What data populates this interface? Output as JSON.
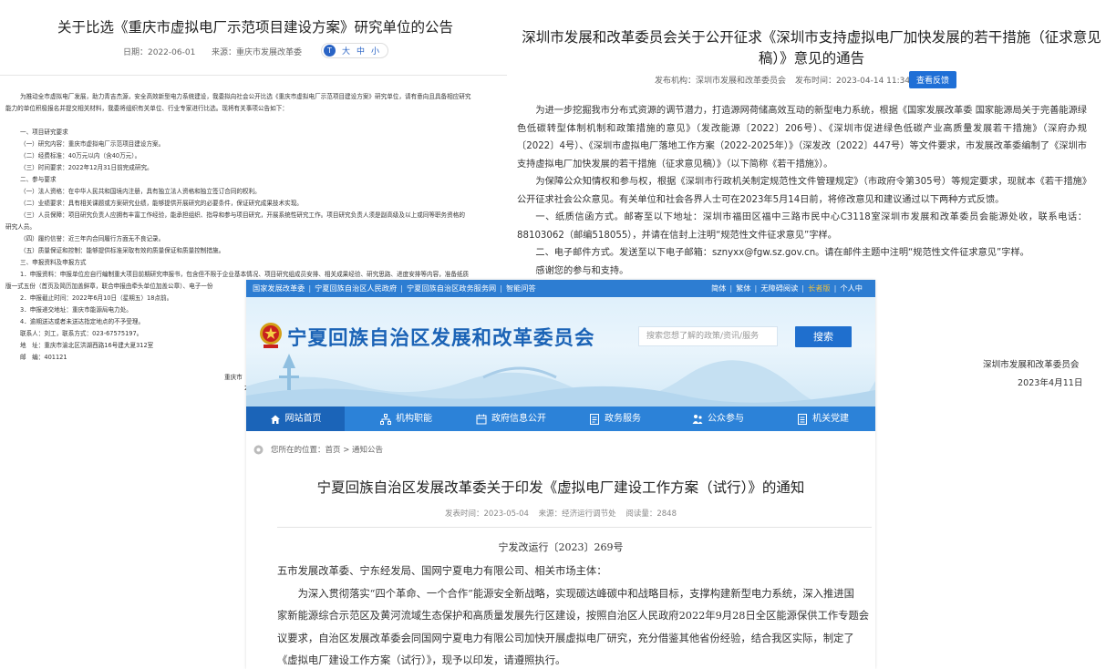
{
  "chongqing": {
    "title": "关于比选《重庆市虚拟电厂示范项目建设方案》研究单位的公告",
    "date": "日期：2022-06-01",
    "source": "来源：重庆市发展改革委",
    "font_size_options": [
      "大",
      "中",
      "小"
    ],
    "font_toggle_icon_text": "T",
    "body_lines": [
      {
        "text": "为推动全市虚拟电厂发展，助力青吉杰源，安全高效新型电力系统建设，我委拟向社会公开比选《重庆市虚拟电厂示范项目建设方案》研究单位，请有意向且具备相应研究",
        "indent": "ind"
      },
      {
        "text": "能力的单位积极报名并提交相关材料，我委将组织有关单位、行业专家进行比选。现将有关事项公告如下：",
        "indent": ""
      },
      {
        "text": "",
        "indent": ""
      },
      {
        "text": "一、项目研究要求",
        "indent": "ind"
      },
      {
        "text": "（一）研究内容：重庆市虚拟电厂示范项目建设方案。",
        "indent": "ind"
      },
      {
        "text": "（二）经费标准：40万元以内（含40万元）。",
        "indent": "ind"
      },
      {
        "text": "（三）时间要求：2022年12月31日前完成研究。",
        "indent": "ind"
      },
      {
        "text": "二、参与要求",
        "indent": "ind"
      },
      {
        "text": "（一）法人资格：在中华人民共和国境内注册，具有独立法人资格和独立签订合同的权利。",
        "indent": "ind"
      },
      {
        "text": "（二）业绩要求：具有相关课题或方案研究业绩，能够提供开展研究的必要条件，保证研究成果技术实现。",
        "indent": "ind"
      },
      {
        "text": "（三）人员保障：项目研究负责人应拥有丰富工作经验，能承担组织、指导和参与项目研究，开展系统性研究工作。项目研究负责人须是副高级及以上或同等职务资格的",
        "indent": "ind"
      },
      {
        "text": "研究人员。",
        "indent": ""
      },
      {
        "text": "（四）履约信誉：近三年内合同履行方面无不良记录。",
        "indent": "ind"
      },
      {
        "text": "（五）质量保证和控制：能够提供标准采取有效的质量保证和质量控制措施。",
        "indent": "ind"
      },
      {
        "text": "三、申报资料及申报方式",
        "indent": "ind"
      },
      {
        "text": "1．申报资料：申报单位应自行编制重大项目前期研究申报书，包含但不限于企业基本情况、项目研究组成员安排、相关成果经验、研究思路、进度安排等内容，准备纸质",
        "indent": "ind"
      },
      {
        "text": "版一式五份（首页及简历加盖鲜章，联合申报由牵头单位加盖公章）、电子一份",
        "indent": ""
      },
      {
        "text": "2．申报截止时间：2022年6月10日（星期五）18点前。",
        "indent": "ind"
      },
      {
        "text": "3．申报递交地址：重庆市能源局电力处。",
        "indent": "ind"
      },
      {
        "text": "4．逾期送达或者未送达指定地点的不予受理。",
        "indent": "ind"
      },
      {
        "text": "联系人：刘工，联系方式：023-67575197。",
        "indent": "ind"
      },
      {
        "text": "地　址：重庆市渝北区洪湖西路16号建大夏312室",
        "indent": "ind"
      },
      {
        "text": "邮　编：401121",
        "indent": "ind"
      }
    ],
    "signature_name": "重庆市",
    "signature_date": "2"
  },
  "shenzhen": {
    "title": "深圳市发展和改革委员会关于公开征求《深圳市支持虚拟电厂加快发展的若干措施（征求意见稿）》意见的通告",
    "publisher": "发布机构：深圳市发展和改革委员会",
    "publish_time": "发布时间：2023-04-14 11:34",
    "feedback_button": "查看反馈",
    "paragraphs": [
      "为进一步挖掘我市分布式资源的调节潜力，打造源网荷储高效互动的新型电力系统，根据《国家发展改革委 国家能源局关于完善能源绿色低碳转型体制机制和政策措施的意见》（发改能源〔2022〕206号）、《深圳市促进绿色低碳产业高质量发展若干措施》（深府办规〔2022〕4号）、《深圳市虚拟电厂落地工作方案（2022-2025年）》（深发改〔2022〕447号）等文件要求，市发展改革委编制了《深圳市支持虚拟电厂加快发展的若干措施（征求意见稿）》（以下简称《若干措施》）。",
      "为保障公众知情权和参与权，根据《深圳市行政机关制定规范性文件管理规定》（市政府令第305号）等规定要求，现就本《若干措施》公开征求社会公众意见。有关单位和社会各界人士可在2023年5月14日前，将修改意见和建议通过以下两种方式反馈。",
      "一、纸质信函方式。邮寄至以下地址：深圳市福田区福中三路市民中心C3118室深圳市发展和改革委员会能源处收，联系电话：88103062（邮编518055），并请在信封上注明“规范性文件征求意见”字样。",
      "二、电子邮件方式。发送至以下电子邮箱：sznyxx@fgw.sz.gov.cn。请在邮件主题中注明“规范性文件征求意见”字样。",
      "感谢您的参与和支持。"
    ],
    "signature": "深圳市发展和改革委员会",
    "signature_date": "2023年4月11日"
  },
  "ningxia": {
    "topbar_left": [
      "国家发展改革委",
      "宁夏回族自治区人民政府",
      "宁夏回族自治区政务服务网",
      "智能问答"
    ],
    "topbar_right": [
      "简体",
      "繁体",
      "无障碍阅读",
      "长者版",
      "个人中"
    ],
    "site_name": "宁夏回族自治区发展和改革委员会",
    "search_placeholder": "搜索您想了解的政策/资讯/服务",
    "search_button": "搜索",
    "nav": [
      {
        "label": "网站首页",
        "icon": "home-icon"
      },
      {
        "label": "机构职能",
        "icon": "org-icon"
      },
      {
        "label": "政府信息公开",
        "icon": "calendar-icon"
      },
      {
        "label": "政务服务",
        "icon": "document-icon"
      },
      {
        "label": "公众参与",
        "icon": "people-icon"
      },
      {
        "label": "机关党建",
        "icon": "party-icon"
      }
    ],
    "breadcrumb": "您所在的位置：首页 > 通知公告",
    "notice_title": "宁夏回族自治区发展改革委关于印发《虚拟电厂建设工作方案（试行）》的通知",
    "publish_time": "发表时间：2023-05-04",
    "source": "来源：经济运行调节处",
    "views": "阅读量：2848",
    "doc_number": "宁发改运行〔2023〕269号",
    "body_lines": [
      {
        "text": "五市发展改革委、宁东经发局、国网宁夏电力有限公司、相关市场主体：",
        "indent": ""
      },
      {
        "text": "为深入贯彻落实“四个革命、一个合作”能源安全新战略，实现碳达峰碳中和战略目标，支撑构建新型电力系统，深入推进国",
        "indent": "ind"
      },
      {
        "text": "家新能源综合示范区及黄河流域生态保护和高质量发展先行区建设，按照自治区人民政府2022年9月28日全区能源保供工作专题会",
        "indent": ""
      },
      {
        "text": "议要求，自治区发展改革委会同国网宁夏电力有限公司加快开展虚拟电厂研究，充分借鉴其他省份经验，结合我区实际，制定了",
        "indent": ""
      },
      {
        "text": "《虚拟电厂建设工作方案（试行）》，现予以印发，请遵照执行。",
        "indent": ""
      }
    ]
  }
}
